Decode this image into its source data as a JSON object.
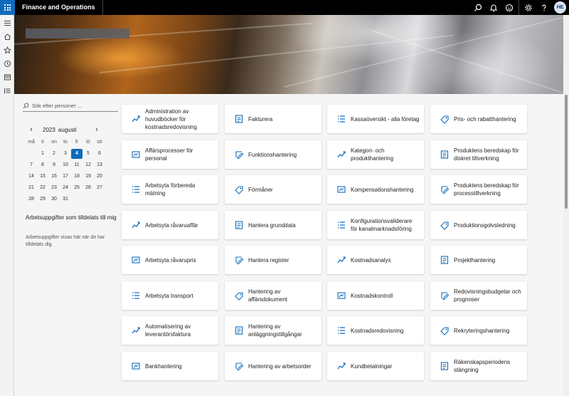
{
  "app": {
    "title": "Finance and Operations",
    "user_initials": "HE"
  },
  "topbar_icons": [
    "search-icon",
    "bell-icon",
    "smiley-icon",
    "gear-icon",
    "help-icon"
  ],
  "banner": {
    "label": ""
  },
  "search": {
    "placeholder": "Sök efter personer ..."
  },
  "calendar": {
    "year": "2023",
    "month": "augusti",
    "weekdays": [
      "må",
      "ti",
      "on",
      "to",
      "fr",
      "lö",
      "sö"
    ],
    "weeks": [
      [
        "",
        "1",
        "2",
        "3",
        "4",
        "5",
        "6"
      ],
      [
        "7",
        "8",
        "9",
        "10",
        "11",
        "12",
        "13"
      ],
      [
        "14",
        "15",
        "16",
        "17",
        "18",
        "19",
        "20"
      ],
      [
        "21",
        "22",
        "23",
        "24",
        "25",
        "26",
        "27"
      ],
      [
        "28",
        "29",
        "30",
        "31",
        "",
        "",
        ""
      ]
    ],
    "today": "4"
  },
  "tasks": {
    "title": "Arbetsuppgifter som tilldelats till mig",
    "subtitle": "Arbetsuppgifter visas här när de har tilldelats dig."
  },
  "tiles": [
    [
      "Administration av huvudböcker för kostnadsredovisning",
      "Fakturera",
      "Kassaöversikt - alla företag",
      "Pris- och rabatthantering"
    ],
    [
      "Affärsprocesser för personal",
      "Funktionshantering",
      "Kategori- och produkthantering",
      "Produktens beredskap för diskret tillverkning"
    ],
    [
      "Arbetsyta förbereda mätning",
      "Förmåner",
      "Kompensationshantering",
      "Produktens beredskap för processtillverkning"
    ],
    [
      "Arbetsyta råvaruaffär",
      "Hantera grunddata",
      "Konfigurationsvaliderare för kanalmarknadsföring",
      "Produktionsgolvsledning"
    ],
    [
      "Arbetsyta råvarupris",
      "Hantera register",
      "Kostnadsanalys",
      "Projekthantering"
    ],
    [
      "Arbetsyta transport",
      "Hantering av affärsdokument",
      "Kostnadskontroll",
      "Redovisningsbudgetar och prognoser"
    ],
    [
      "Automatisering av leverantörsfaktura",
      "Hantering av anläggningstillgångar",
      "Kostnadsredovisning",
      "Rekryteringshantering"
    ],
    [
      "Bankhantering",
      "Hantering av arbetsorder",
      "Kundbetalningar",
      "Räkenskapsperiodens stängning"
    ]
  ],
  "colors": {
    "accent": "#0f6cbd",
    "topbar": "#000000"
  }
}
